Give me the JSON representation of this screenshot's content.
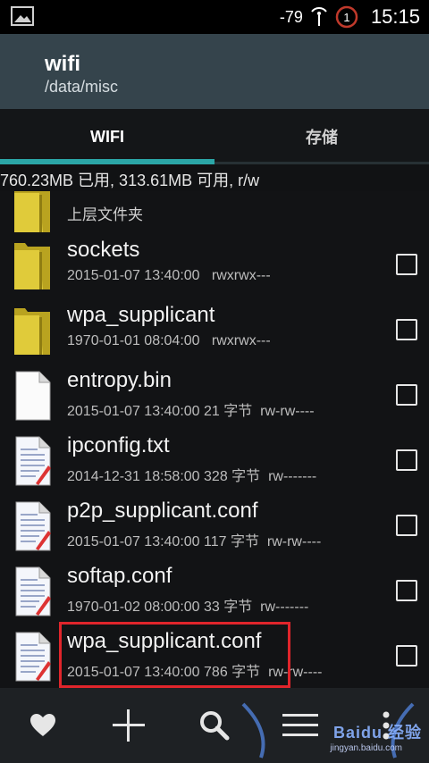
{
  "status_bar": {
    "signal": "-79",
    "time": "15:15"
  },
  "app_bar": {
    "title": "wifi",
    "path": "/data/misc"
  },
  "tabs": [
    {
      "label": "WIFI",
      "active": true
    },
    {
      "label": "存储",
      "active": false
    }
  ],
  "storage_info": "760.23MB 已用, 313.61MB 可用, r/w",
  "files": {
    "parent_label": "上层文件夹",
    "items": [
      {
        "name": "sockets",
        "date": "2015-01-07 13:40:00",
        "size": "",
        "perm": "rwxrwx---",
        "type": "folder"
      },
      {
        "name": "wpa_supplicant",
        "date": "1970-01-01 08:04:00",
        "size": "",
        "perm": "rwxrwx---",
        "type": "folder"
      },
      {
        "name": "entropy.bin",
        "date": "2015-01-07 13:40:00",
        "size": "21 字节",
        "perm": "rw-rw----",
        "type": "binary"
      },
      {
        "name": "ipconfig.txt",
        "date": "2014-12-31 18:58:00",
        "size": "328 字节",
        "perm": "rw-------",
        "type": "text"
      },
      {
        "name": "p2p_supplicant.conf",
        "date": "2015-01-07 13:40:00",
        "size": "117 字节",
        "perm": "rw-rw----",
        "type": "text"
      },
      {
        "name": "softap.conf",
        "date": "1970-01-02 08:00:00",
        "size": "33 字节",
        "perm": "rw-------",
        "type": "text"
      },
      {
        "name": "wpa_supplicant.conf",
        "date": "2015-01-07 13:40:00",
        "size": "786 字节",
        "perm": "rw-rw----",
        "type": "text"
      }
    ]
  },
  "bottom_bar": {
    "icons": [
      "heart-icon",
      "plus-icon",
      "search-icon",
      "menu-icon",
      "more-icon"
    ]
  },
  "watermark": {
    "brand": "Baidu 经验",
    "site": "jingyan.baidu.com"
  },
  "colors": {
    "app_bar": "#35444c",
    "tab_indicator": "#2ba6a7",
    "highlight": "#e0252b",
    "folder": "#d7c12a"
  }
}
